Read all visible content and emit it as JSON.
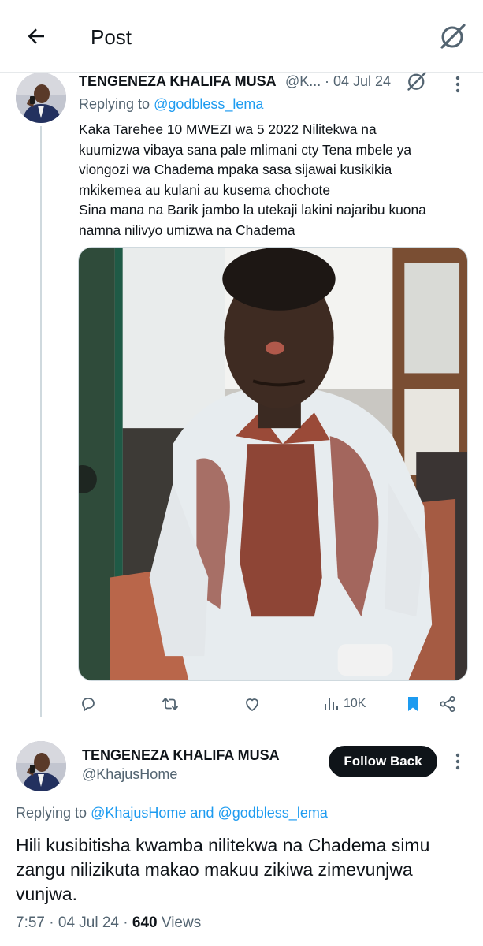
{
  "header": {
    "title": "Post"
  },
  "parent_tweet": {
    "author_name": "TENGENEZA KHALIFA MUSA",
    "author_handle": "@K...",
    "date": "· 04 Jul 24",
    "replying_label": "Replying to",
    "replying_to": "@godbless_lema",
    "text_lines": [
      "Kaka Tarehee 10 MWEZI wa 5 2022 Nilitekwa na",
      "kuumizwa vibaya sana pale mlimani cty Tena mbele ya",
      "viongozi wa Chadema mpaka sasa sijawai kusikikia",
      "mkikemea au kulani au kusema chochote",
      "Sina mana na Barik jambo la utekaji lakini najaribu kuona",
      "namna nilivyo umizwa na Chadema"
    ],
    "views": "10K"
  },
  "main_tweet": {
    "author_name": "TENGENEZA KHALIFA MUSA",
    "author_handle": "@KhajusHome",
    "follow_label": "Follow Back",
    "replying_label": "Replying to",
    "replying_to_1": "@KhajusHome",
    "replying_and": "and",
    "replying_to_2": "@godbless_lema",
    "text_lines": [
      "Hili kusibitisha kwamba nilitekwa na Chadema simu",
      "zangu nilizikuta makao makuu zikiwa zimevunjwa",
      "vunjwa."
    ],
    "time": "7:57",
    "date": "· 04 Jul 24 ·",
    "views_count": "640",
    "views_label": "Views"
  },
  "colors": {
    "link": "#1d9bf0",
    "secondary_text": "#536471",
    "primary_text": "#0f1419",
    "bookmark_active": "#1d9bf0"
  },
  "icons": [
    "back-arrow-icon",
    "grok-icon",
    "more-icon",
    "reply-icon",
    "retweet-icon",
    "like-icon",
    "views-icon",
    "bookmark-icon",
    "share-icon"
  ]
}
